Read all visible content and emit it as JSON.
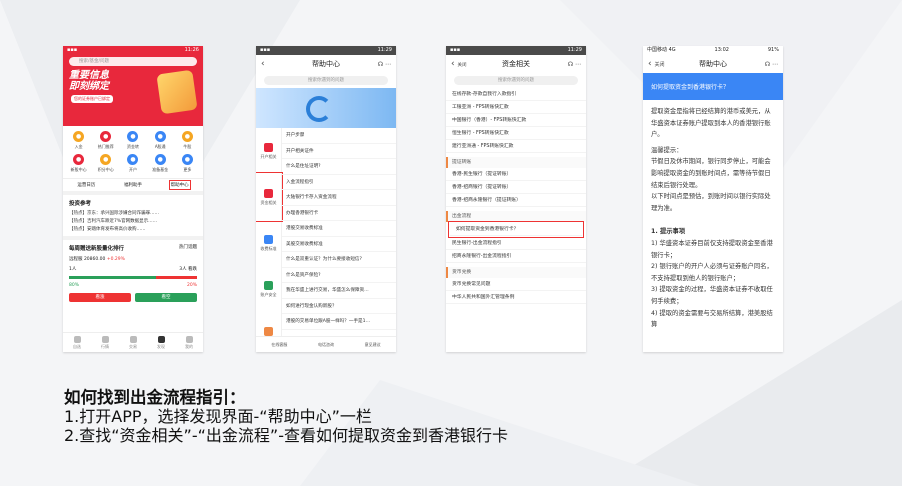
{
  "p1": {
    "search": "搜索/基金/问题",
    "banner_title": [
      "重要信息",
      "即刻绑定"
    ],
    "banner_sub": "您的证券账户已绑定",
    "grid": [
      {
        "label": "入金",
        "icon": "deposit-icon",
        "color": "#f5a623"
      },
      {
        "label": "热门推荐",
        "icon": "hot-icon",
        "color": "#e8283c"
      },
      {
        "label": "资金转",
        "icon": "transfer-icon",
        "color": "#3a86f5"
      },
      {
        "label": "A股通",
        "icon": "a-share-icon",
        "color": "#3a86f5"
      },
      {
        "label": "牛股",
        "icon": "stock-icon",
        "color": "#f5a623"
      },
      {
        "label": "新股中心",
        "icon": "ipo-icon",
        "color": "#e8283c"
      },
      {
        "label": "积分中心",
        "icon": "points-icon",
        "color": "#f5a623"
      },
      {
        "label": "开户",
        "icon": "account-icon",
        "color": "#3a86f5"
      },
      {
        "label": "准备基金",
        "icon": "fund-icon",
        "color": "#3a86f5"
      },
      {
        "label": "更多",
        "icon": "more-icon",
        "color": "#3a86f5"
      }
    ],
    "trio": [
      "运营日历",
      "福利助手",
      "帮助中心"
    ],
    "news_title": "投资参考",
    "news": [
      "【热点】京东：承兴国际涉嫌合同诈骗罪……",
      "【热点】吉利汽车跌近7%官网数据显示……",
      "【热点】安踏体育发布将高价收购……"
    ],
    "pk_title": "每周赠送新股量化排行",
    "pk_more": "热门话题",
    "pk_code": "远程服",
    "pk_val": "20860.00",
    "pk_pct": "+0.29%",
    "pk_l": "80%",
    "pk_r": "20%",
    "pk_l_count": "1人",
    "pk_r_count": "3人 看跌",
    "buy": "看涨",
    "sell": "看空",
    "tabs": [
      "自选",
      "行情",
      "交易",
      "发现",
      "我的"
    ]
  },
  "p2": {
    "title": "帮助中心",
    "search": "搜索你遇到的问题",
    "cats": [
      {
        "label": "开户相关",
        "color": "#e8283c"
      },
      {
        "label": "资金相关",
        "color": "#e8283c"
      },
      {
        "label": "收费标准",
        "color": "#3a86f5"
      },
      {
        "label": "账户安全",
        "color": "#2aa05a"
      },
      {
        "label": "港股交易",
        "color": "#e84"
      }
    ],
    "qs": [
      "开户步骤",
      "开户相关证件",
      "什么是住址证明?",
      "入金流程指引",
      "大陆银行卡存入资金流程",
      "办理香港银行卡",
      "港股交易收费标准",
      "美股交易收费标准",
      "什么是双重认证？为什么要接收短信?",
      "什么是资产保险?",
      "我在华盛上进行交易，华盛怎么保障资…",
      "如何进行现金认购新股？",
      "港股的交易单位跟A股一样吗？一手是1…"
    ],
    "bottom": [
      "在线客服",
      "电话咨询",
      "意见建议"
    ]
  },
  "p3": {
    "title": "资金相关",
    "back": "关闭",
    "search": "搜索你遇到的问题",
    "top": [
      "在线存款-存款自我行入款指引",
      "工银亚洲 - FPS转账快汇款",
      "中国银行（香港）- FPS转账快汇款",
      "恒生银行 - FPS转账快汇款",
      "建行亚洲通 - FPS转账快汇款"
    ],
    "g1": "提证转账",
    "g1_items": [
      "香港-民生银行（提证转账）",
      "香港-招商银行（提证转账）",
      "香港-招商永隆银行（提证转账）"
    ],
    "g2": "出金流程",
    "g2_items": [
      "如何提取资金到香港银行卡？",
      "民生银行-出金流程指引",
      "招商永隆银行-出金流程指引"
    ],
    "g3": "货币兑换",
    "g3_items": [
      "货币兑换常见问题",
      "中华人民共和国外汇管理条例"
    ]
  },
  "p4": {
    "status": "中国移动 4G",
    "time": "13:02",
    "battery": "91%",
    "title": "帮助中心",
    "back": "关闭",
    "question": "如何提取资金到香港银行卡？",
    "para1": "提取资金是指将已经结算的港币或美元，从华盛资本证券账户提取到本人的香港银行账户。",
    "para2": "温馨提示：",
    "para3": "节假日及休市期间，银行同步停止，可能会影响提取资金的到账时间点，需等待节假日结束后银行处理。",
    "para4": "以下时间点是预估，到账时间以银行实际处理为准。",
    "notes_title": "1. 提示事项",
    "notes": [
      "1) 华盛资本证券目前仅支持提取资金至香港银行卡；",
      "2) 银行账户的开户人必须与证券账户同名，不支持提取到他人的银行账户；",
      "3) 提取资金的过程，华盛资本证券不收取任何手续费；",
      "4) 提取的资金需要与交易所结算，港美股结算"
    ]
  },
  "caption": {
    "title": "如何找到出金流程指引：",
    "line1": "1.打开APP，选择发现界面-“帮助中心”一栏",
    "line2": "2.查找“资金相关”-“出金流程”-查看如何提取资金到香港银行卡"
  }
}
